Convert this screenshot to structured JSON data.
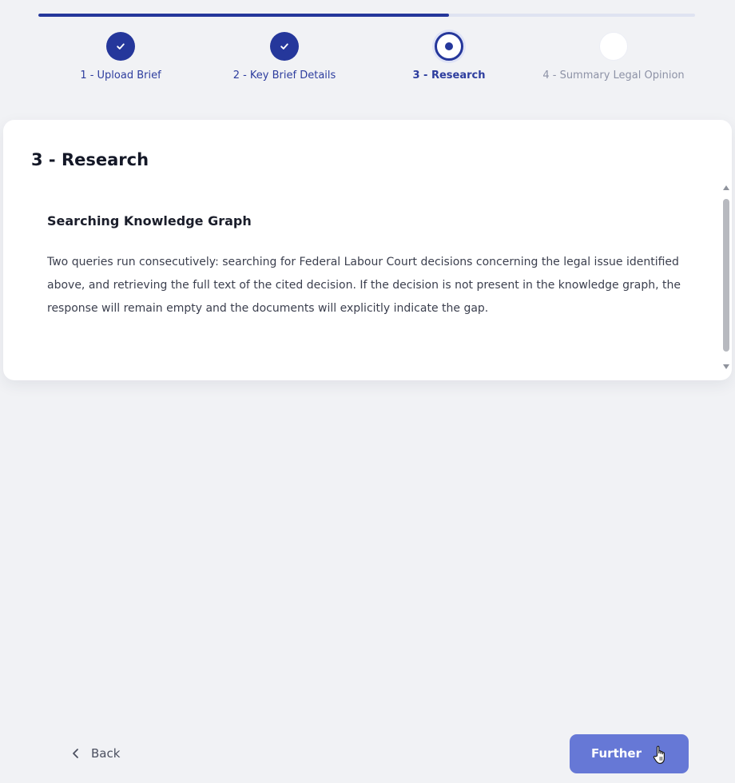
{
  "stepper": {
    "progress_fraction": 0.625,
    "steps": [
      {
        "label": "1 - Upload Brief",
        "status": "done"
      },
      {
        "label": "2 - Key Brief Details",
        "status": "done"
      },
      {
        "label": "3 - Research",
        "status": "current"
      },
      {
        "label": "4 - Summary Legal Opinion",
        "status": "pending"
      }
    ]
  },
  "card": {
    "title": "3 - Research",
    "section": {
      "title": "Searching Knowledge Graph",
      "body": "Two queries run consecutively: searching for Federal Labour Court decisions concerning the legal issue identified above, and retrieving the full text of the cited decision. If the decision is not present in the knowledge graph, the response will remain empty and the documents will explicitly indicate the gap."
    }
  },
  "footer": {
    "back_label": "Back",
    "further_label": "Further"
  },
  "icons": {
    "step_done": "check-icon",
    "step_current": "dot-icon",
    "back": "chevron-left-icon",
    "cursor": "hand-pointer-icon"
  },
  "colors": {
    "accent": "#25379b",
    "track": "#dfe3f1",
    "button": "#6678d6",
    "background": "#f1f2f5",
    "card": "#ffffff"
  }
}
